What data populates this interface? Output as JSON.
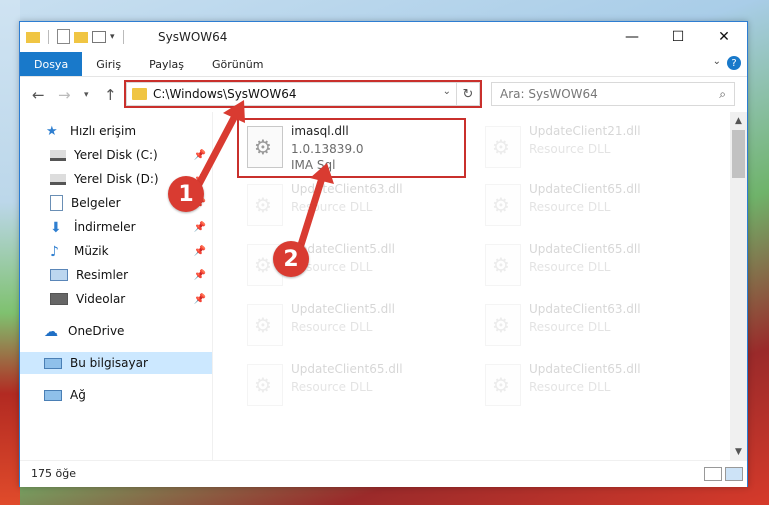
{
  "window": {
    "title": "SysWOW64",
    "minimize": "—",
    "maximize": "☐",
    "close": "✕"
  },
  "ribbon": {
    "tabs": [
      "Dosya",
      "Giriş",
      "Paylaş",
      "Görünüm"
    ],
    "help": "?"
  },
  "address": {
    "path": "C:\\Windows\\SysWOW64"
  },
  "search": {
    "placeholder": "Ara: SysWOW64"
  },
  "nav_pane": {
    "items": [
      {
        "label": "Hızlı erişim",
        "icon": "star-icon"
      },
      {
        "label": "Yerel Disk (C:)",
        "icon": "drive-icon"
      },
      {
        "label": "Yerel Disk (D:)",
        "icon": "drive-icon"
      },
      {
        "label": "Belgeler",
        "icon": "documents-icon"
      },
      {
        "label": "İndirmeler",
        "icon": "download-icon"
      },
      {
        "label": "Müzik",
        "icon": "music-icon"
      },
      {
        "label": "Resimler",
        "icon": "pictures-icon"
      },
      {
        "label": "Videolar",
        "icon": "video-icon"
      },
      {
        "label": "OneDrive",
        "icon": "cloud-icon"
      },
      {
        "label": "Bu bilgisayar",
        "icon": "computer-icon"
      },
      {
        "label": "Ağ",
        "icon": "network-icon"
      }
    ]
  },
  "files": {
    "highlighted": {
      "name": "imasql.dll",
      "version": "1.0.13839.0",
      "description": "IMA Sql"
    },
    "faded": [
      {
        "name": "UpdateClient21.dll",
        "description": "Resource DLL"
      },
      {
        "name": "UpdateClient63.dll",
        "description": "Resource DLL"
      },
      {
        "name": "UpdateClient65.dll",
        "description": "Resource DLL"
      },
      {
        "name": "UpdateClient5.dll",
        "description": "Resource DLL"
      },
      {
        "name": "UpdateClient65.dll",
        "description": "Resource DLL"
      },
      {
        "name": "UpdateClient5.dll",
        "description": "Resource DLL"
      },
      {
        "name": "UpdateClient63.dll",
        "description": "Resource DLL"
      },
      {
        "name": "UpdateClient65.dll",
        "description": "Resource DLL"
      },
      {
        "name": "UpdateClient65.dll",
        "description": "Resource DLL"
      }
    ]
  },
  "status": {
    "count": "175 öğe"
  },
  "annotations": {
    "badge1": "1",
    "badge2": "2",
    "color": "#d93b31"
  }
}
